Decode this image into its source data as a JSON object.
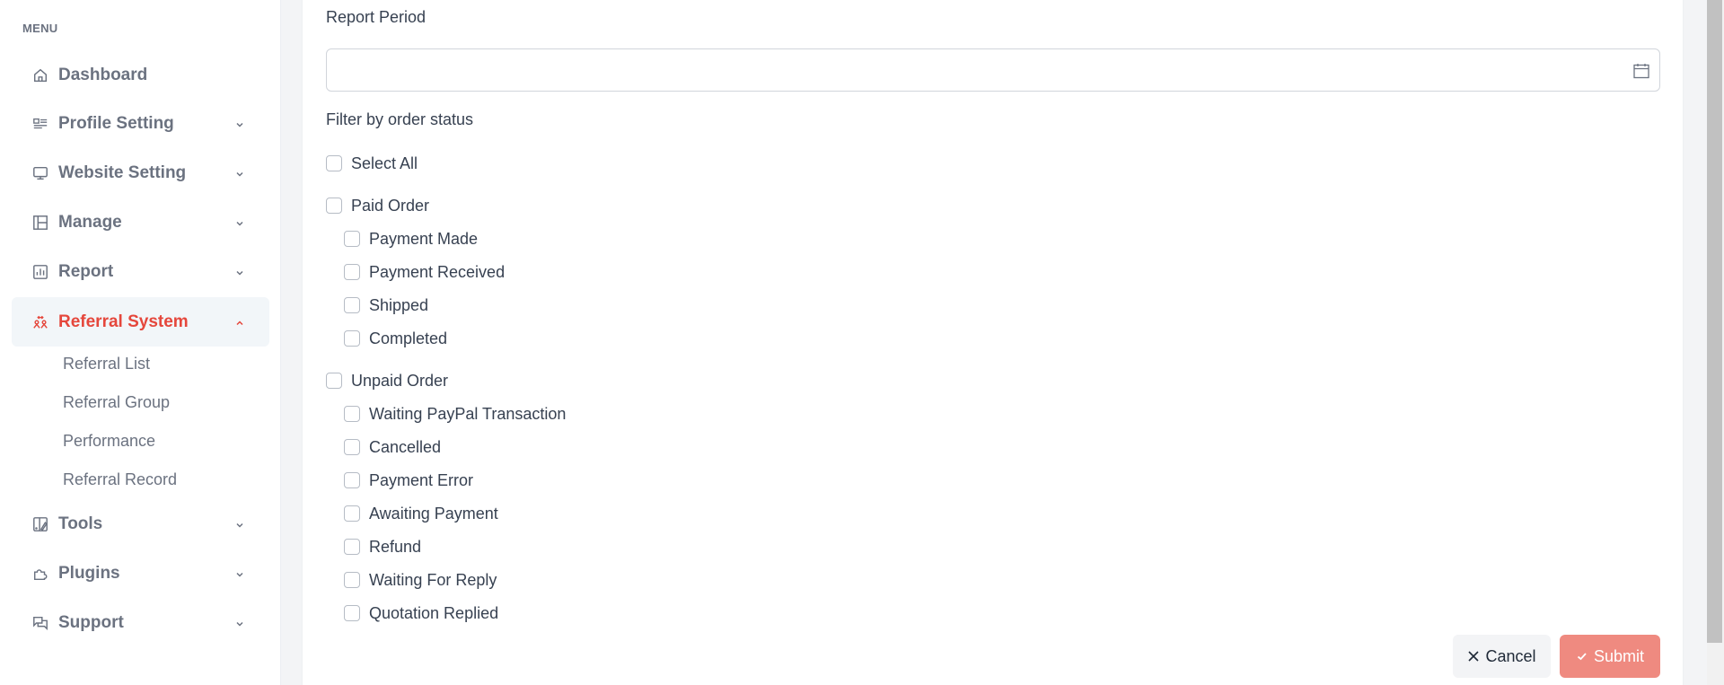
{
  "sidebar": {
    "menu_label": "MENU",
    "items": [
      {
        "label": "Dashboard",
        "icon": "home-icon",
        "has_chevron": false
      },
      {
        "label": "Profile Setting",
        "icon": "profile-list-icon",
        "has_chevron": true
      },
      {
        "label": "Website Setting",
        "icon": "monitor-icon",
        "has_chevron": true
      },
      {
        "label": "Manage",
        "icon": "layout-icon",
        "has_chevron": true
      },
      {
        "label": "Report",
        "icon": "bar-chart-icon",
        "has_chevron": true
      },
      {
        "label": "Referral System",
        "icon": "referral-users-icon",
        "has_chevron": true,
        "active": true,
        "expanded": true
      },
      {
        "label": "Tools",
        "icon": "tools-icon",
        "has_chevron": true
      },
      {
        "label": "Plugins",
        "icon": "puzzle-icon",
        "has_chevron": true
      },
      {
        "label": "Support",
        "icon": "chat-icon",
        "has_chevron": true
      }
    ],
    "referral_subitems": [
      "Referral List",
      "Referral Group",
      "Performance",
      "Referral Record"
    ]
  },
  "form": {
    "report_period_label": "Report Period",
    "report_period_value": "",
    "filter_label": "Filter by order status",
    "select_all": {
      "label": "Select All",
      "checked": false
    },
    "groups": [
      {
        "label": "Paid Order",
        "checked": false,
        "options": [
          {
            "label": "Payment Made",
            "checked": false
          },
          {
            "label": "Payment Received",
            "checked": false
          },
          {
            "label": "Shipped",
            "checked": false
          },
          {
            "label": "Completed",
            "checked": false
          }
        ]
      },
      {
        "label": "Unpaid Order",
        "checked": false,
        "options": [
          {
            "label": "Waiting PayPal Transaction",
            "checked": false
          },
          {
            "label": "Cancelled",
            "checked": false
          },
          {
            "label": "Payment Error",
            "checked": false
          },
          {
            "label": "Awaiting Payment",
            "checked": false
          },
          {
            "label": "Refund",
            "checked": false
          },
          {
            "label": "Waiting For Reply",
            "checked": false
          },
          {
            "label": "Quotation Replied",
            "checked": false
          }
        ]
      }
    ],
    "cancel_label": "Cancel",
    "submit_label": "Submit"
  },
  "colors": {
    "accent": "#e5473c",
    "submit_bg": "#ef8a80",
    "muted_text": "#6b7280"
  }
}
